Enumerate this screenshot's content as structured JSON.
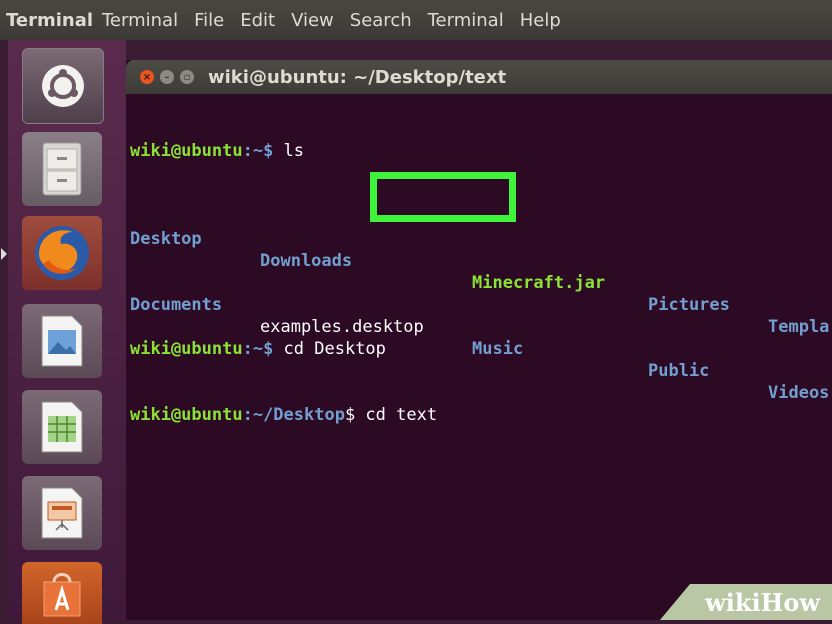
{
  "topbar": {
    "app_name": "Terminal",
    "menu": [
      "Terminal",
      "File",
      "Edit",
      "View",
      "Search",
      "Terminal",
      "Help"
    ]
  },
  "window": {
    "title": "wiki@ubuntu: ~/Desktop/text"
  },
  "terminal": {
    "line1": {
      "user": "wiki@ubuntu",
      "path": ":~$",
      "cmd": " ls"
    },
    "ls_row1": [
      "Desktop",
      "Downloads",
      "Minecraft.jar",
      "Pictures",
      "Templa"
    ],
    "ls_row2": [
      "Documents",
      "examples.desktop",
      "Music",
      "Public",
      "Videos"
    ],
    "line3": {
      "user": "wiki@ubuntu",
      "path": ":~$",
      "cmd": " cd Desktop"
    },
    "line4": {
      "user": "wiki@ubuntu",
      "path": ":~/Desktop",
      "cmd": "$ cd text"
    }
  },
  "launcher_icons": [
    "ubuntu-logo-icon",
    "files-icon",
    "firefox-icon",
    "image-viewer-icon",
    "spreadsheet-icon",
    "presentation-icon",
    "software-center-icon"
  ],
  "watermark": {
    "wiki": "wiki",
    "how": "How"
  },
  "colors": {
    "highlight": "#3ff23a",
    "prompt_user": "#8ae234",
    "prompt_path": "#729fcf",
    "terminal_bg": "#2c0a24"
  }
}
